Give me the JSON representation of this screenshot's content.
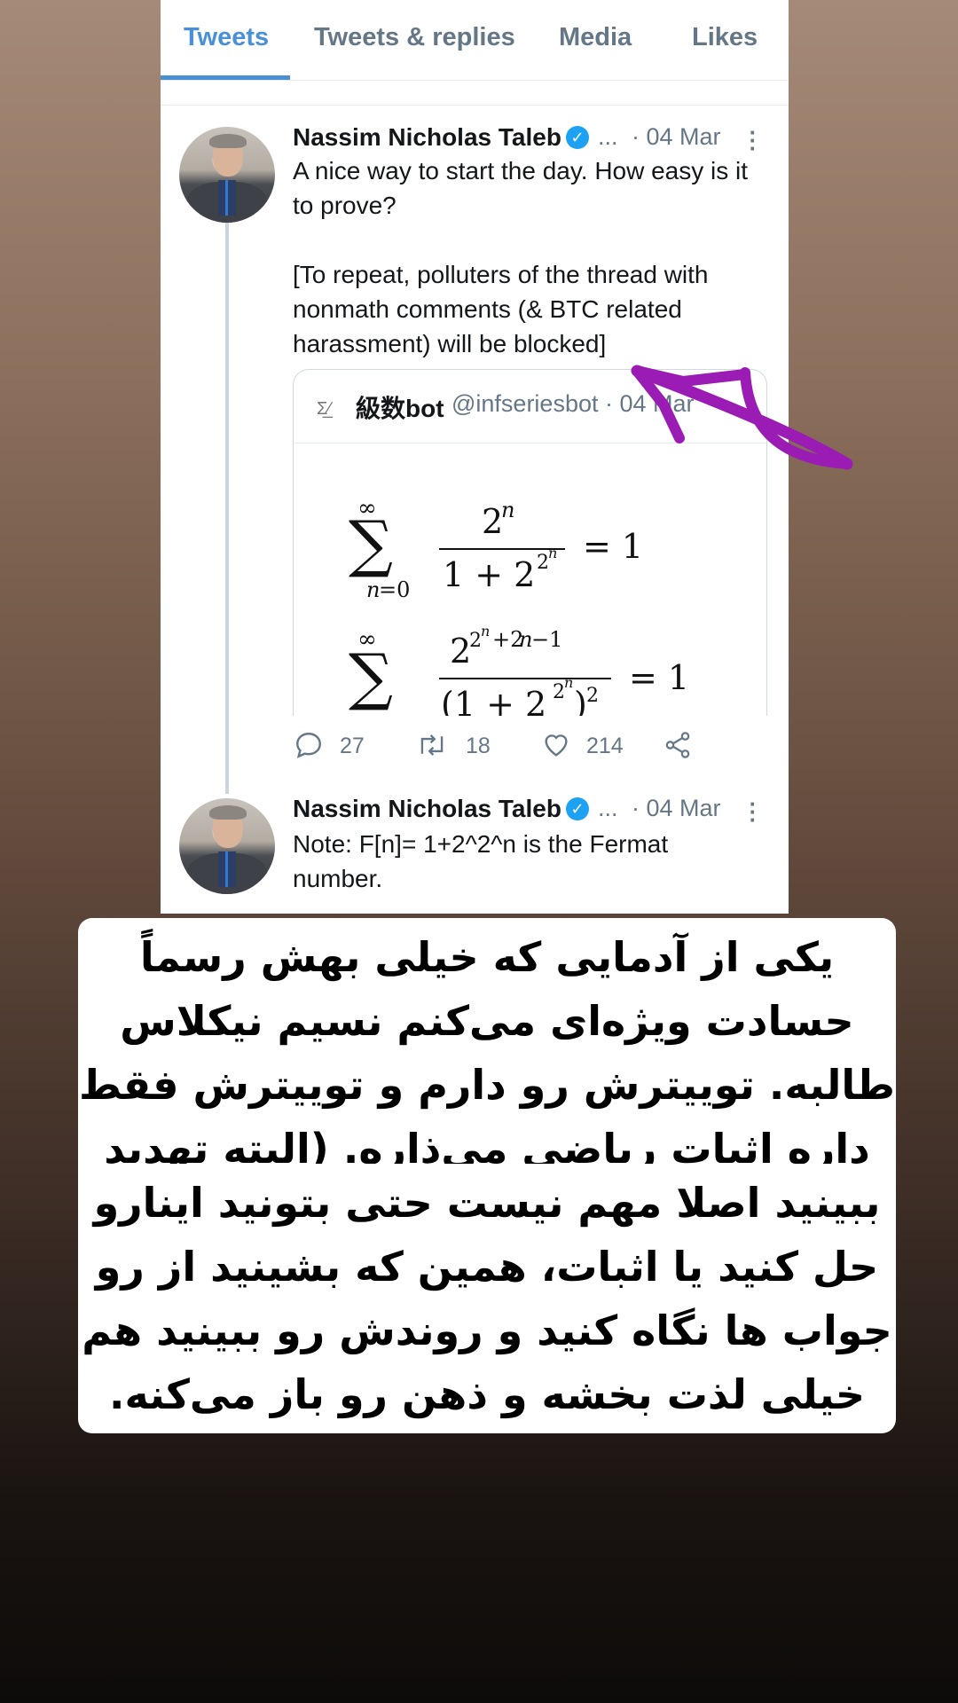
{
  "tabs": [
    "Tweets",
    "Tweets & replies",
    "Media",
    "Likes"
  ],
  "tweet1": {
    "author": "Nassim Nicholas Taleb",
    "ellipsis": "...",
    "date": "· 04 Mar",
    "text": "A nice way to start the day. How easy is it to prove?\n\n[To repeat, polluters of the thread with nonmath  comments (& BTC related harassment) will be blocked]",
    "quote": {
      "name": "級数bot",
      "handle": "@infseriesbot · 04 Mar"
    },
    "replies": "27",
    "retweets": "18",
    "likes": "214"
  },
  "tweet2": {
    "author": "Nassim Nicholas Taleb",
    "ellipsis": "...",
    "date": "· 04 Mar",
    "text": "Note: F[n]= 1+2^2^n is the Fermat number."
  },
  "captions": {
    "first": "یکی از آدمایی که خیلی بهش رسماً حسادت ویژه‌ای می‌کنم نسیم نیکلاس طالبه. توییترش رو دارم و توییترش فقط داره اثبات ریاضی می‌ذاره. (البته تهدید به بلاک هم می‌کنه)",
    "second": "ببینید اصلا مهم نیست حتی بتونید اینارو حل کنید یا اثبات، همین که بشینید از رو جواب ها نگاه کنید و روندش رو ببینید هم خیلی لذت بخشه و ذهن رو باز می‌کنه."
  },
  "colors": {
    "accent": "#4a90d9",
    "arrow": "#9b1bb5"
  }
}
